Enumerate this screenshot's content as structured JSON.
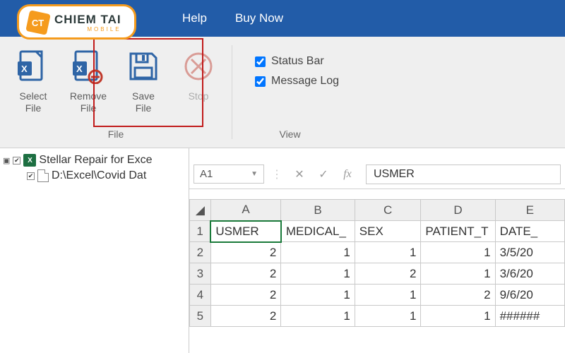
{
  "menu": {
    "help": "Help",
    "buy": "Buy Now"
  },
  "logo": {
    "icon": "CT",
    "line1": "CHIEM TAI",
    "line2": "MOBILE"
  },
  "ribbon": {
    "file_group": "File",
    "view_group": "View",
    "select_file": "Select\nFile",
    "remove_file": "Remove\nFile",
    "save_file": "Save\nFile",
    "stop": "Stop",
    "status_bar": "Status Bar",
    "message_log": "Message Log"
  },
  "tree": {
    "root": "Stellar Repair for Exce",
    "child": "D:\\Excel\\Covid Dat"
  },
  "formula": {
    "namebox": "A1",
    "value": "USMER"
  },
  "chart_data": {
    "type": "table",
    "columns": [
      "A",
      "B",
      "C",
      "D",
      "E"
    ],
    "headers_row1": [
      "USMER",
      "MEDICAL_",
      "SEX",
      "PATIENT_T",
      "DATE_"
    ],
    "rows": [
      {
        "n": "1",
        "A": "USMER",
        "B": "MEDICAL_",
        "C": "SEX",
        "D": "PATIENT_T",
        "E": "DATE_"
      },
      {
        "n": "2",
        "A": "2",
        "B": "1",
        "C": "1",
        "D": "1",
        "E": "3/5/20"
      },
      {
        "n": "3",
        "A": "2",
        "B": "1",
        "C": "2",
        "D": "1",
        "E": "3/6/20"
      },
      {
        "n": "4",
        "A": "2",
        "B": "1",
        "C": "1",
        "D": "2",
        "E": "9/6/20"
      },
      {
        "n": "5",
        "A": "2",
        "B": "1",
        "C": "1",
        "D": "1",
        "E": "######"
      }
    ]
  }
}
